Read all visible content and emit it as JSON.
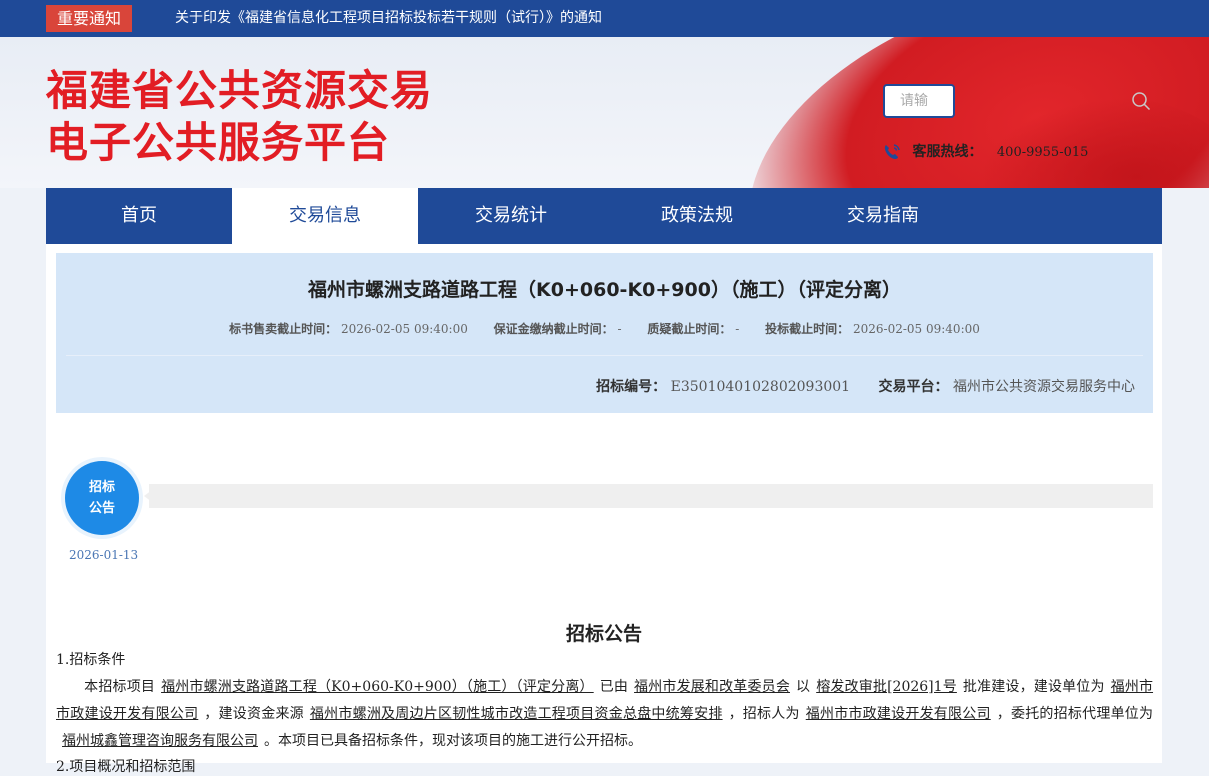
{
  "topbar": {
    "badge": "重要通知",
    "notice": "关于印发《福建省信息化工程项目招标投标若干规则（试行）》的通知"
  },
  "header": {
    "logo_line1": "福建省公共资源交易",
    "logo_line2": "电子公共服务平台",
    "search_placeholder": "请输",
    "hotline_label": "客服热线：",
    "hotline_number": "400-9955-015"
  },
  "nav": [
    {
      "label": "首页"
    },
    {
      "label": "交易信息"
    },
    {
      "label": "交易统计"
    },
    {
      "label": "政策法规"
    },
    {
      "label": "交易指南"
    }
  ],
  "project": {
    "title": "福州市螺洲支路道路工程（K0+060-K0+900）（施工）（评定分离）",
    "sale_deadline_label": "标书售卖截止时间：",
    "sale_deadline": "2026-02-05 09:40:00",
    "deposit_deadline_label": "保证金缴纳截止时间：",
    "deposit_deadline": "-",
    "query_deadline_label": "质疑截止时间：",
    "query_deadline": "-",
    "bid_deadline_label": "投标截止时间：",
    "bid_deadline": "2026-02-05 09:40:00",
    "code_label": "招标编号：",
    "code": "E3501040102802093001",
    "platform_label": "交易平台：",
    "platform": "福州市公共资源交易服务中心"
  },
  "timeline": {
    "step_line1": "招标",
    "step_line2": "公告",
    "date": "2026-01-13"
  },
  "document": {
    "title": "招标公告",
    "section1": "1.招标条件",
    "p_a": "本招标项目",
    "u_project": "福州市螺洲支路道路工程（K0+060-K0+900）（施工）（评定分离）",
    "p_b": "已由",
    "u_approver": "福州市发展和改革委员会",
    "p_c": "以",
    "u_approval_no": "榕发改审批[2026]1号",
    "p_d": "批准建设，建设单位为",
    "u_builder": "福州市市政建设开发有限公司",
    "p_e": "，建设资金来源",
    "u_funding": "福州市螺洲及周边片区韧性城市改造工程项目资金总盘中统筹安排",
    "p_f": "，招标人为",
    "u_tenderer": "福州市市政建设开发有限公司",
    "p_g": "，委托的招标代理单位为",
    "u_agent": "福州城鑫管理咨询服务有限公司",
    "p_h": "。本项目已具备招标条件，现对该项目的施工进行公开招标。",
    "section2": "2.项目概况和招标范围"
  },
  "colors": {
    "nav_blue": "#1f4a98",
    "logo_red": "#e21d24",
    "badge_red": "#d9453a",
    "circle_blue": "#1e8ae6",
    "info_bg": "#d5e6f8"
  }
}
